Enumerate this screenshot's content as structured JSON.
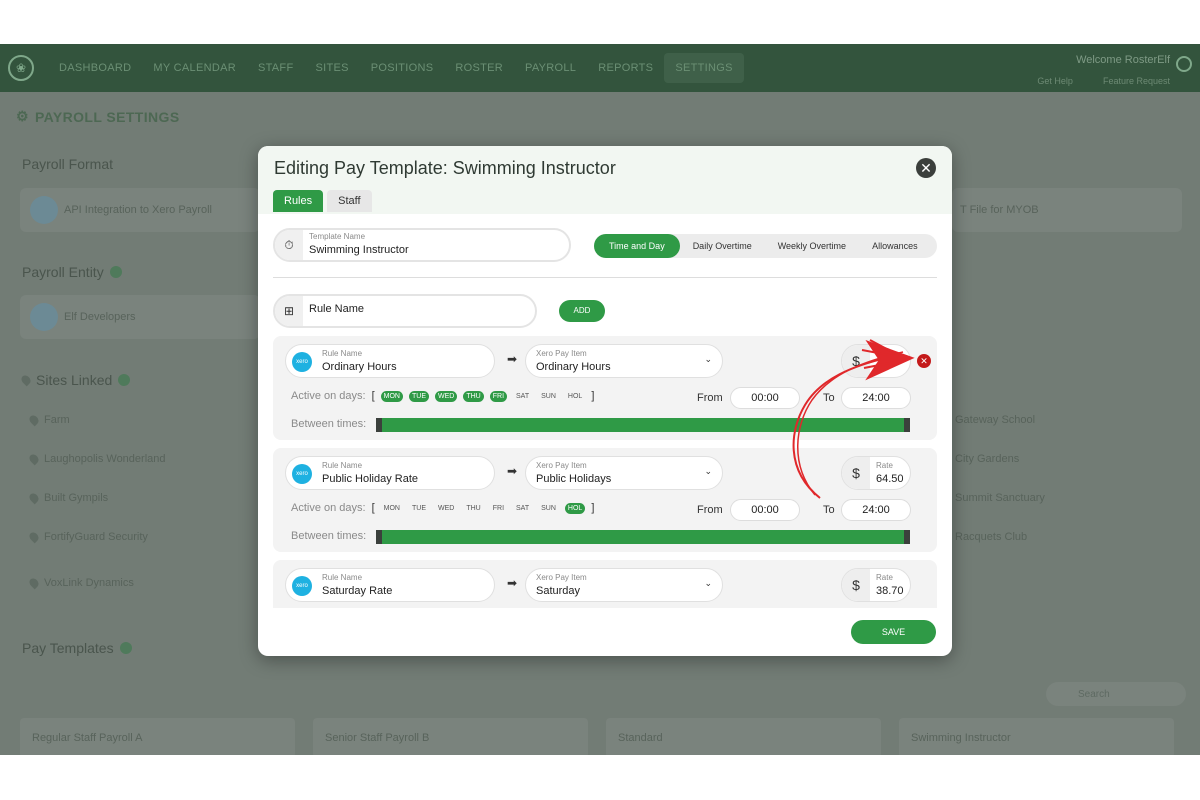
{
  "nav": {
    "items": [
      "DASHBOARD",
      "MY CALENDAR",
      "STAFF",
      "SITES",
      "POSITIONS",
      "ROSTER",
      "PAYROLL",
      "REPORTS",
      "SETTINGS"
    ],
    "active": "SETTINGS",
    "welcome": "Welcome RosterElf",
    "get_help": "Get Help",
    "feature_request": "Feature Request"
  },
  "page": {
    "title": "PAYROLL SETTINGS",
    "payroll_format": "Payroll Format",
    "payroll_format_cards": [
      "API Integration to Xero Payroll",
      "T File for MYOB"
    ],
    "payroll_entity": "Payroll Entity",
    "entity_card": "Elf Developers",
    "sites_linked": "Sites Linked",
    "sites_left": [
      "Farm",
      "Laughopolis Wonderland",
      "Built Gympils",
      "FortifyGuard Security",
      "VoxLink Dynamics"
    ],
    "sites_right": [
      "Gateway School",
      "City Gardens",
      "Summit Sanctuary",
      "Racquets Club"
    ],
    "pay_templates": "Pay Templates",
    "templates": [
      "Regular Staff Payroll A",
      "Senior Staff Payroll B",
      "Standard",
      "Swimming Instructor"
    ],
    "search_placeholder": "Search"
  },
  "modal": {
    "title": "Editing Pay Template: Swimming Instructor",
    "tabs": [
      "Rules",
      "Staff"
    ],
    "template_name_label": "Template Name",
    "template_name_value": "Swimming Instructor",
    "segments": [
      "Time and Day",
      "Daily Overtime",
      "Weekly Overtime",
      "Allowances"
    ],
    "rule_name_placeholder": "Rule Name",
    "add_label": "ADD",
    "save_label": "SAVE",
    "labels": {
      "rule_name": "Rule Name",
      "xero_pay_item": "Xero Pay Item",
      "rate": "Rate",
      "active_on_days": "Active on days:",
      "between_times": "Between times:",
      "from": "From",
      "to": "To",
      "xero": "xero"
    },
    "days": [
      "MON",
      "TUE",
      "WED",
      "THU",
      "FRI",
      "SAT",
      "SUN",
      "HOL"
    ],
    "rules": [
      {
        "rule_name": "Ordinary Hours",
        "pay_item": "Ordinary Hours",
        "rate": "",
        "from": "00:00",
        "to": "24:00",
        "active_days": [
          "MON",
          "TUE",
          "WED",
          "THU",
          "FRI"
        ]
      },
      {
        "rule_name": "Public Holiday Rate",
        "pay_item": "Public Holidays",
        "rate": "64.50",
        "from": "00:00",
        "to": "24:00",
        "active_days": [
          "HOL"
        ]
      },
      {
        "rule_name": "Saturday Rate",
        "pay_item": "Saturday",
        "rate": "38.70"
      }
    ]
  },
  "colors": {
    "green": "#2f9a46",
    "nav": "#33543d",
    "delete": "#c41a1a",
    "annotation": "#e0282b"
  },
  "icons": {
    "close": "close-icon",
    "delete": "delete-rule-icon",
    "dollar": "dollar-icon",
    "arrow": "arrow-right-icon",
    "chevron": "chevron-down-icon"
  }
}
